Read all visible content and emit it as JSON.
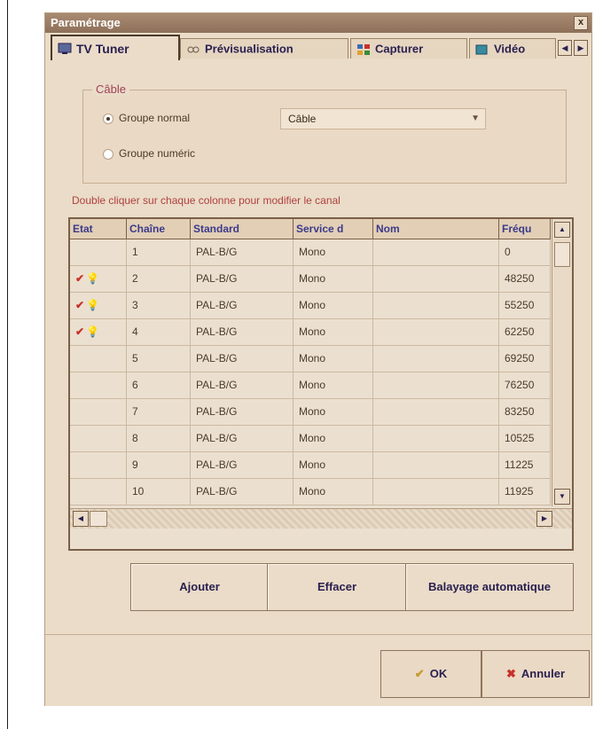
{
  "window": {
    "title": "Paramétrage",
    "close_glyph": "x"
  },
  "tabs": [
    {
      "label": "TV Tuner",
      "icon": "tv-icon",
      "active": true
    },
    {
      "label": "Prévisualisation",
      "icon": "preview-icon",
      "active": false
    },
    {
      "label": "Capturer",
      "icon": "capture-icon",
      "active": false
    },
    {
      "label": "Vidéo",
      "icon": "video-icon",
      "active": false
    }
  ],
  "tab_scroll": {
    "left": "◀",
    "right": "▶"
  },
  "group": {
    "label": "Câble",
    "radio_normal": "Groupe normal",
    "radio_numeric": "Groupe numéric",
    "selected": "normal",
    "select_value": "Câble"
  },
  "hint": "Double cliquer sur chaque colonne pour modifier le canal",
  "table": {
    "columns": [
      "Etat",
      "Chaîne",
      "Standard",
      "Service d",
      "Nom",
      "Fréqu"
    ],
    "rows": [
      {
        "state": false,
        "channel": "1",
        "standard": "PAL-B/G",
        "service": "Mono",
        "name": "",
        "freq": "0"
      },
      {
        "state": true,
        "channel": "2",
        "standard": "PAL-B/G",
        "service": "Mono",
        "name": "",
        "freq": "48250"
      },
      {
        "state": true,
        "channel": "3",
        "standard": "PAL-B/G",
        "service": "Mono",
        "name": "",
        "freq": "55250"
      },
      {
        "state": true,
        "channel": "4",
        "standard": "PAL-B/G",
        "service": "Mono",
        "name": "",
        "freq": "62250"
      },
      {
        "state": false,
        "channel": "5",
        "standard": "PAL-B/G",
        "service": "Mono",
        "name": "",
        "freq": "69250"
      },
      {
        "state": false,
        "channel": "6",
        "standard": "PAL-B/G",
        "service": "Mono",
        "name": "",
        "freq": "76250"
      },
      {
        "state": false,
        "channel": "7",
        "standard": "PAL-B/G",
        "service": "Mono",
        "name": "",
        "freq": "83250"
      },
      {
        "state": false,
        "channel": "8",
        "standard": "PAL-B/G",
        "service": "Mono",
        "name": "",
        "freq": "10525"
      },
      {
        "state": false,
        "channel": "9",
        "standard": "PAL-B/G",
        "service": "Mono",
        "name": "",
        "freq": "11225"
      },
      {
        "state": false,
        "channel": "10",
        "standard": "PAL-B/G",
        "service": "Mono",
        "name": "",
        "freq": "11925"
      }
    ],
    "state_check": "✔",
    "state_bulb": "💡"
  },
  "scroll": {
    "up": "▲",
    "down": "▼",
    "left": "◀",
    "right": "▶"
  },
  "actions": {
    "add": "Ajouter",
    "clear": "Effacer",
    "scan": "Balayage automatique"
  },
  "footer": {
    "ok": "OK",
    "cancel": "Annuler",
    "ok_glyph": "✔",
    "cancel_glyph": "✖"
  },
  "colors": {
    "dialog_bg": "#eadcc8",
    "accent_red": "#c8302a",
    "header_text": "#3a3a8a"
  }
}
